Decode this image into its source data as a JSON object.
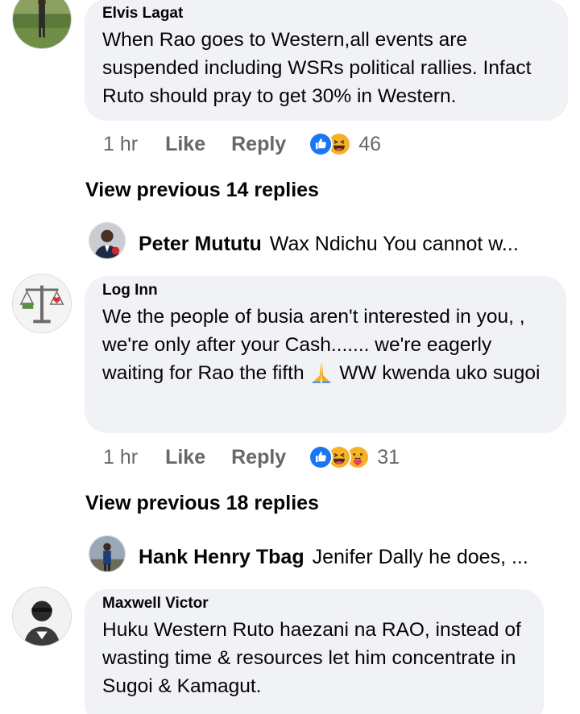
{
  "comments": [
    {
      "author": "Elvis Lagat",
      "text": "When Rao goes to Western,all events are suspended including WSRs political rallies. Infact  Ruto should pray to get 30% in Western.",
      "time": "1 hr",
      "like_label": "Like",
      "reply_label": "Reply",
      "reaction_count": "46",
      "reactions": [
        "like-icon",
        "haha-icon"
      ],
      "view_previous": "View previous 14 replies",
      "latest_reply": {
        "author": "Peter Mututu",
        "text": "Wax Ndichu You cannot w..."
      }
    },
    {
      "author": "Log Inn",
      "text_parts": [
        "We the people of busia aren't interested in you, , we're only after your Cash....... we're eagerly waiting for Rao the fifth ",
        " WW kwenda uko sugoi"
      ],
      "time": "1 hr",
      "like_label": "Like",
      "reply_label": "Reply",
      "reaction_count": "31",
      "reactions": [
        "like-icon",
        "haha-icon",
        "care-icon"
      ],
      "view_previous": "View previous 18 replies",
      "latest_reply": {
        "author": "Hank Henry Tbag",
        "text": "Jenifer Dally he does, ..."
      }
    },
    {
      "author": "Maxwell Victor",
      "text": "Huku Western Ruto haezani na RAO, instead of wasting time & resources let him concentrate in Sugoi & Kamagut."
    }
  ],
  "colors": {
    "bubble": "#f0f2f5",
    "meta": "#65676b",
    "like_blue": "#1877f2",
    "emoji_yellow": "#f7b125"
  }
}
